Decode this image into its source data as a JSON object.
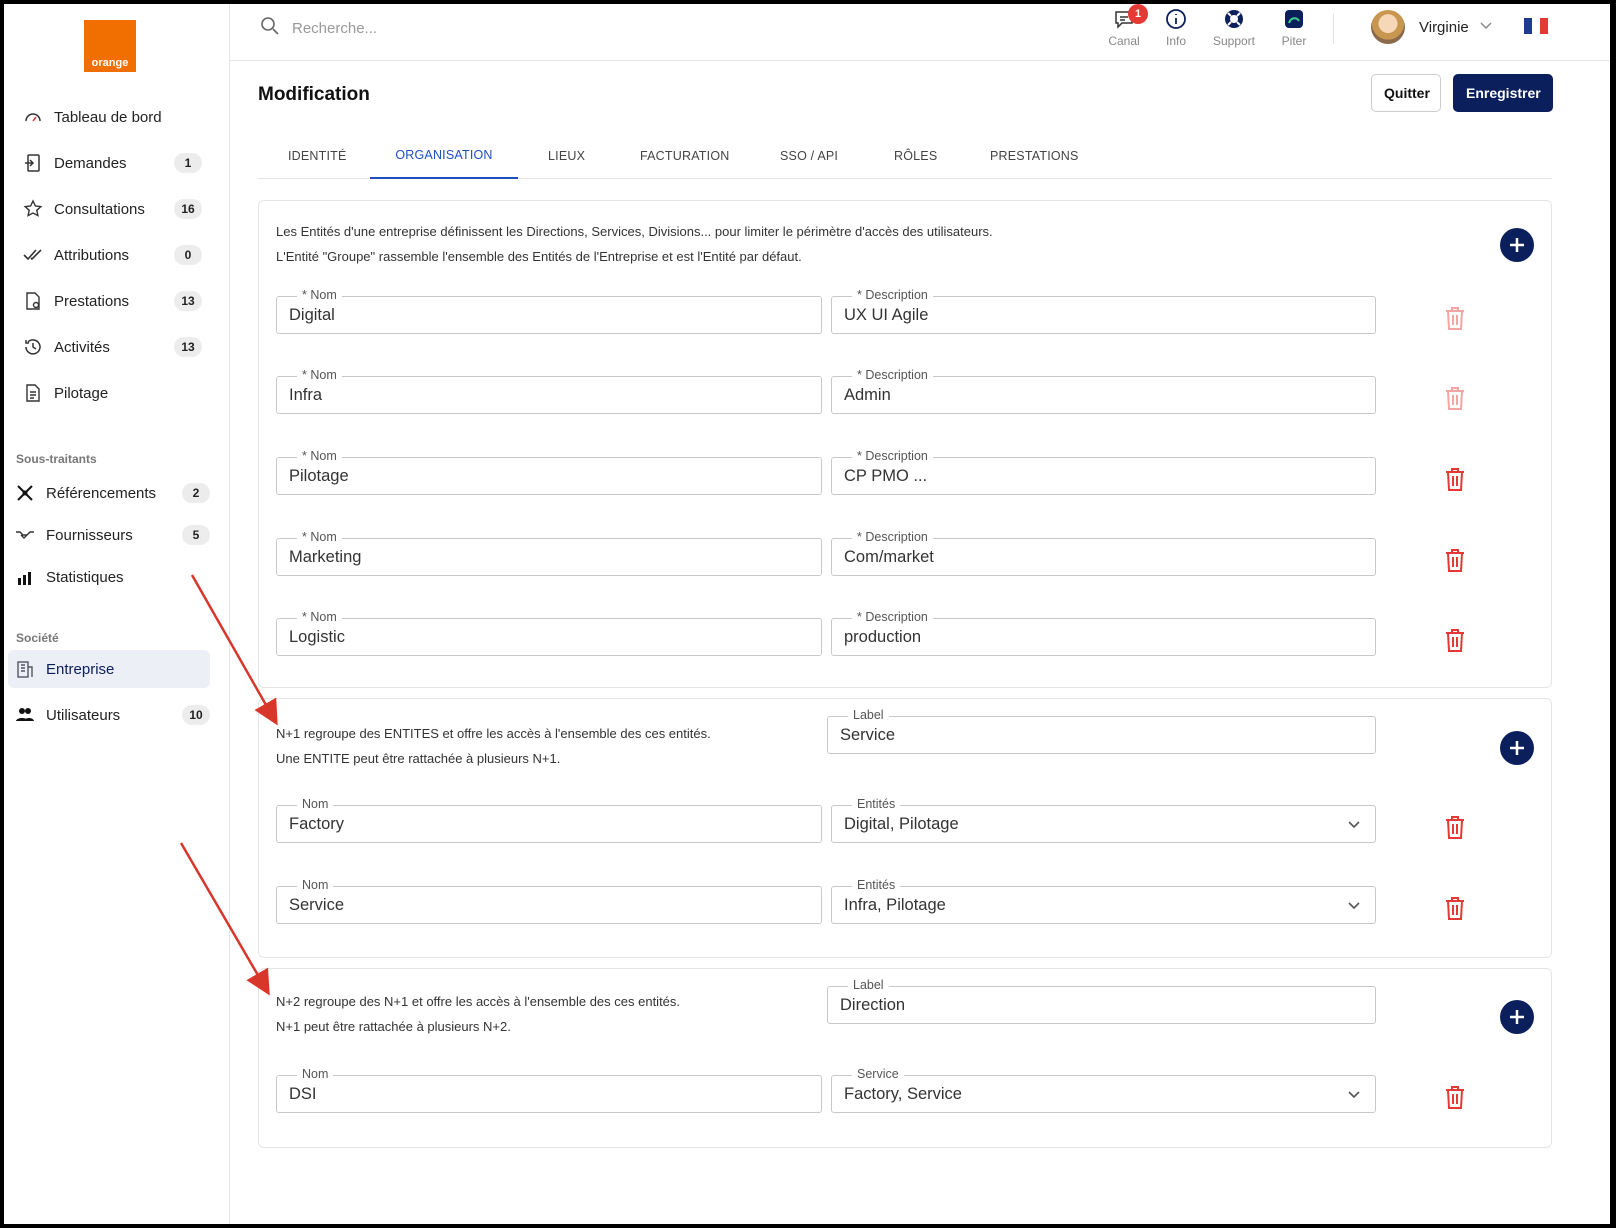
{
  "colors": {
    "brand": "#f16e00",
    "primary": "#0b1f5c",
    "tab_active": "#1f4fbf",
    "danger": "#e53935"
  },
  "sidebar": {
    "logo_text": "orange",
    "items": [
      {
        "label": "Tableau de bord",
        "icon": "gauge-icon",
        "badge": ""
      },
      {
        "label": "Demandes",
        "icon": "inbox-in-icon",
        "badge": "1"
      },
      {
        "label": "Consultations",
        "icon": "star-icon",
        "badge": "16"
      },
      {
        "label": "Attributions",
        "icon": "double-check-icon",
        "badge": "0"
      },
      {
        "label": "Prestations",
        "icon": "document-settings-icon",
        "badge": "13"
      },
      {
        "label": "Activités",
        "icon": "history-clock-icon",
        "badge": "13"
      },
      {
        "label": "Pilotage",
        "icon": "document-icon",
        "badge": ""
      }
    ],
    "section_subcontractors": "Sous-traitants",
    "sub_items": [
      {
        "label": "Référencements",
        "icon": "network-icon",
        "badge": "2"
      },
      {
        "label": "Fournisseurs",
        "icon": "handshake-icon",
        "badge": "5"
      },
      {
        "label": "Statistiques",
        "icon": "chart-icon",
        "badge": ""
      }
    ],
    "section_company": "Société",
    "company_items": [
      {
        "label": "Entreprise",
        "icon": "building-icon",
        "badge": "",
        "active": true
      },
      {
        "label": "Utilisateurs",
        "icon": "users-icon",
        "badge": "10"
      }
    ]
  },
  "topbar": {
    "search_placeholder": "Recherche...",
    "buttons": [
      {
        "label": "Canal",
        "icon": "chat-icon",
        "notification": "1"
      },
      {
        "label": "Info",
        "icon": "info-icon"
      },
      {
        "label": "Support",
        "icon": "lifebuoy-icon"
      },
      {
        "label": "Piter",
        "icon": "piter-chat-icon"
      }
    ],
    "user_name": "Virginie"
  },
  "page": {
    "title": "Modification",
    "quit_label": "Quitter",
    "save_label": "Enregistrer",
    "tabs": [
      "IDENTITÉ",
      "ORGANISATION",
      "LIEUX",
      "FACTURATION",
      "SSO / API",
      "RÔLES",
      "PRESTATIONS"
    ],
    "active_tab": "ORGANISATION"
  },
  "entities": {
    "desc_line1": "Les Entités d'une entreprise définissent les Directions, Services, Divisions... pour limiter le périmètre d'accès des utilisateurs.",
    "desc_line2": "L'Entité \"Groupe\" rassemble l'ensemble des Entités de l'Entreprise et est l'Entité par défaut.",
    "name_label": "* Nom",
    "description_label": "* Description",
    "rows": [
      {
        "name": "Digital",
        "description": "UX UI Agile",
        "delete_enabled": false
      },
      {
        "name": "Infra",
        "description": "Admin",
        "delete_enabled": false
      },
      {
        "name": "Pilotage",
        "description": "CP PMO ...",
        "delete_enabled": true
      },
      {
        "name": "Marketing",
        "description": "Com/market",
        "delete_enabled": true
      },
      {
        "name": "Logistic",
        "description": "production",
        "delete_enabled": true
      }
    ]
  },
  "n1": {
    "desc_line1": "N+1 regroupe des ENTITES et offre les accès à l'ensemble des ces entités.",
    "desc_line2": "Une ENTITE peut être rattachée à plusieurs N+1.",
    "label_legend": "Label",
    "label_value": "Service",
    "name_label": "Nom",
    "select_label": "Entités",
    "rows": [
      {
        "name": "Factory",
        "selection": "Digital, Pilotage"
      },
      {
        "name": "Service",
        "selection": "Infra, Pilotage"
      }
    ]
  },
  "n2": {
    "desc_line1": "N+2 regroupe des N+1 et offre les accès à l'ensemble des ces entités.",
    "desc_line2": "N+1 peut être rattachée à plusieurs N+2.",
    "label_legend": "Label",
    "label_value": "Direction",
    "name_label": "Nom",
    "select_label": "Service",
    "rows": [
      {
        "name": "DSI",
        "selection": "Factory, Service"
      }
    ]
  }
}
